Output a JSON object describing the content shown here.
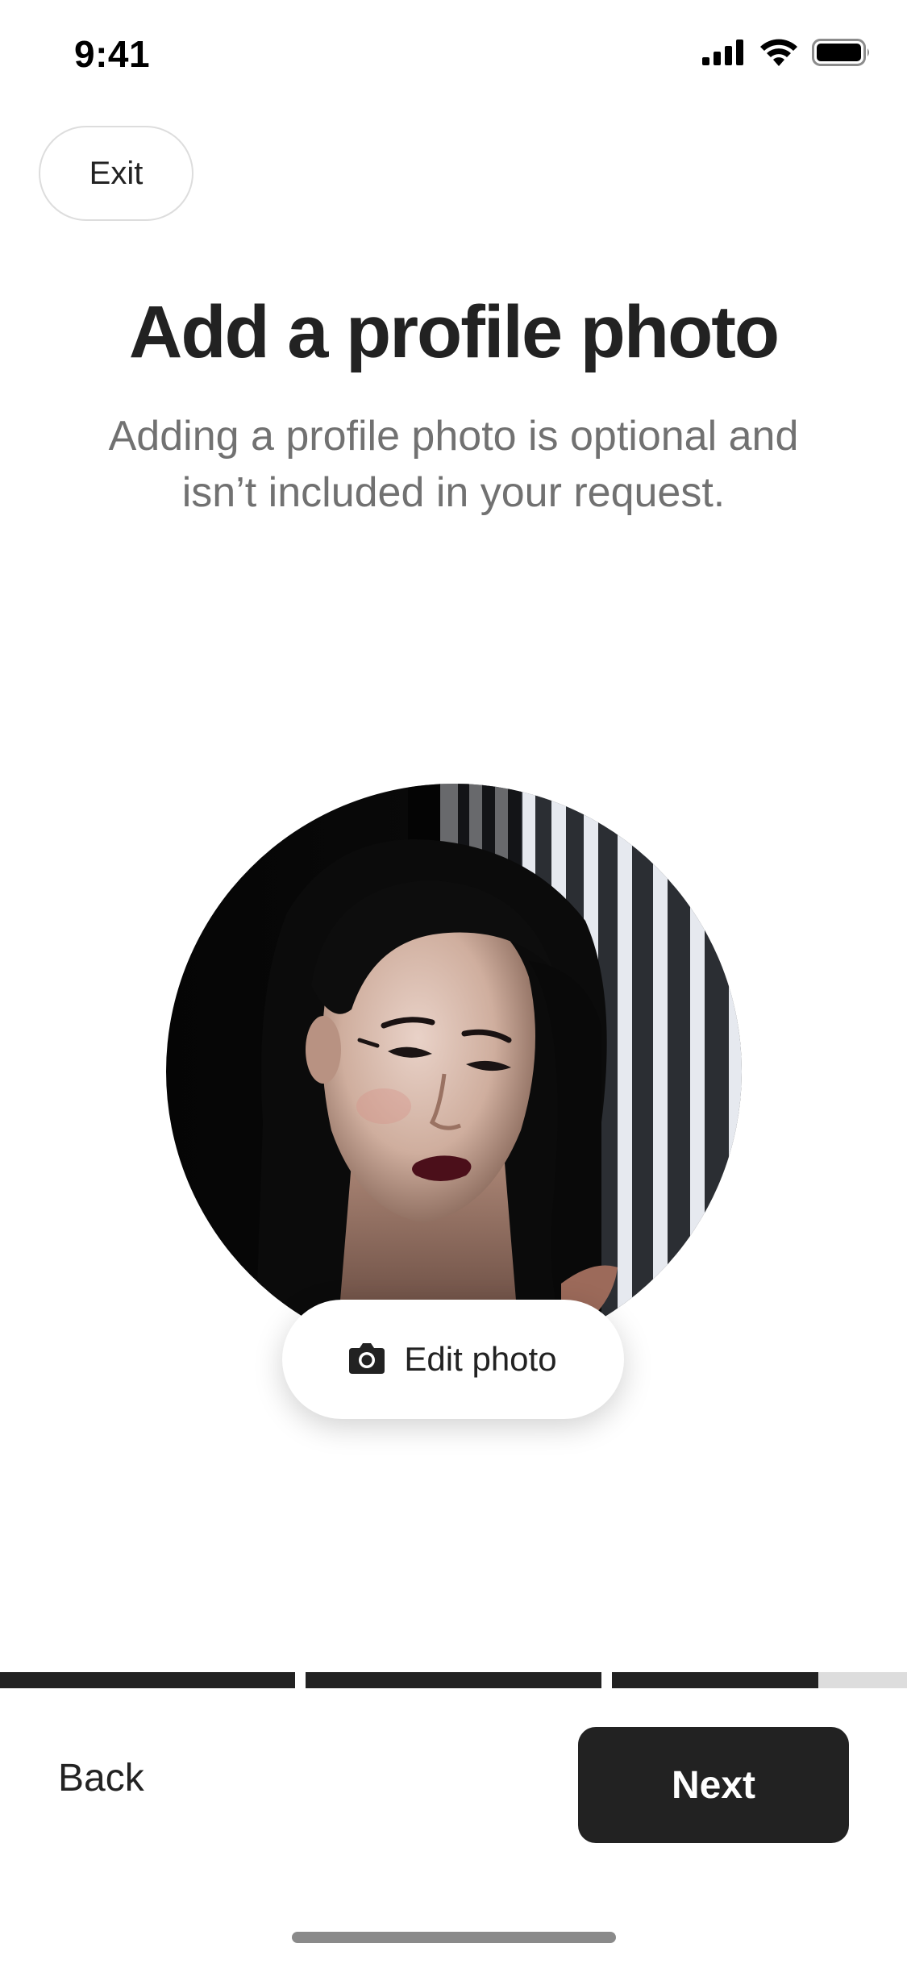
{
  "status_bar": {
    "time": "9:41",
    "icons": [
      "cellular-signal-icon",
      "wifi-icon",
      "battery-icon"
    ]
  },
  "header": {
    "exit_label": "Exit"
  },
  "main": {
    "title": "Add a profile photo",
    "subtitle": "Adding a profile photo is optional and isn’t included in your request.",
    "photo_alt": "Profile photo of a woman with dark hair against a striped wall",
    "edit_photo_label": "Edit photo",
    "edit_photo_icon": "camera-icon"
  },
  "progress": {
    "segments": [
      1,
      1,
      0.7
    ]
  },
  "footer": {
    "back_label": "Back",
    "next_label": "Next"
  },
  "colors": {
    "primary_text": "#222222",
    "secondary_text": "#717171",
    "button_dark": "#222222",
    "border": "#dddddd",
    "progress_track": "#dddddd"
  }
}
